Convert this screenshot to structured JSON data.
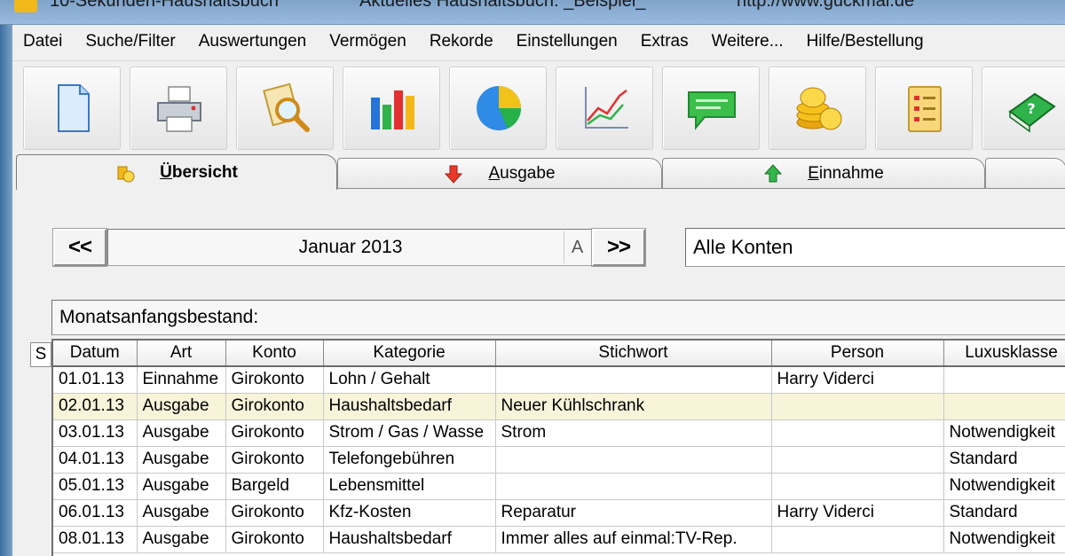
{
  "window": {
    "title_segments": [
      "10-Sekunden-Haushaltsbuch",
      "Aktuelles Haushaltsbuch: _Beispiel_",
      "http://www.guckmal.de"
    ]
  },
  "menu": [
    "Datei",
    "Suche/Filter",
    "Auswertungen",
    "Vermögen",
    "Rekorde",
    "Einstellungen",
    "Extras",
    "Weitere...",
    "Hilfe/Bestellung"
  ],
  "toolbar": [
    {
      "icon": "document-icon"
    },
    {
      "icon": "printer-icon"
    },
    {
      "icon": "magnifier-icon"
    },
    {
      "icon": "bar-chart-icon"
    },
    {
      "icon": "pie-chart-icon"
    },
    {
      "icon": "line-chart-icon"
    },
    {
      "icon": "speech-bubble-icon"
    },
    {
      "icon": "coins-icon"
    },
    {
      "icon": "checklist-icon"
    },
    {
      "icon": "help-book-icon"
    }
  ],
  "tabs": [
    {
      "label": "Übersicht",
      "icon": "coins-small-icon",
      "active": true
    },
    {
      "label": "Ausgabe",
      "icon": "arrow-down-icon",
      "active": false
    },
    {
      "label": "Einnahme",
      "icon": "arrow-up-icon",
      "active": false
    }
  ],
  "navigation": {
    "prev_label": "<<",
    "next_label": ">>",
    "month": "Januar 2013",
    "month_suffix": "A",
    "account": "Alle Konten"
  },
  "opening_balance_label": "Monatsanfangsbestand:",
  "grid": {
    "side_header": "S",
    "columns": [
      "Datum",
      "Art",
      "Konto",
      "Kategorie",
      "Stichwort",
      "Person",
      "Luxusklasse"
    ],
    "rows": [
      [
        "01.01.13",
        "Einnahme",
        "Girokonto",
        "Lohn / Gehalt",
        "",
        "Harry Viderci",
        ""
      ],
      [
        "02.01.13",
        "Ausgabe",
        "Girokonto",
        "Haushaltsbedarf",
        "Neuer Kühlschrank",
        "",
        ""
      ],
      [
        "03.01.13",
        "Ausgabe",
        "Girokonto",
        "Strom / Gas / Wasse",
        "Strom",
        "",
        "Notwendigkeit"
      ],
      [
        "04.01.13",
        "Ausgabe",
        "Girokonto",
        "Telefongebühren",
        "",
        "",
        "Standard"
      ],
      [
        "05.01.13",
        "Ausgabe",
        "Bargeld",
        "Lebensmittel",
        "",
        "",
        "Notwendigkeit"
      ],
      [
        "06.01.13",
        "Ausgabe",
        "Girokonto",
        "Kfz-Kosten",
        "Reparatur",
        "Harry Viderci",
        "Standard"
      ],
      [
        "08.01.13",
        "Ausgabe",
        "Girokonto",
        "Haushaltsbedarf",
        "Immer alles auf einmal:TV-Rep.",
        "",
        "Notwendigkeit"
      ]
    ],
    "highlight_row": 1
  }
}
